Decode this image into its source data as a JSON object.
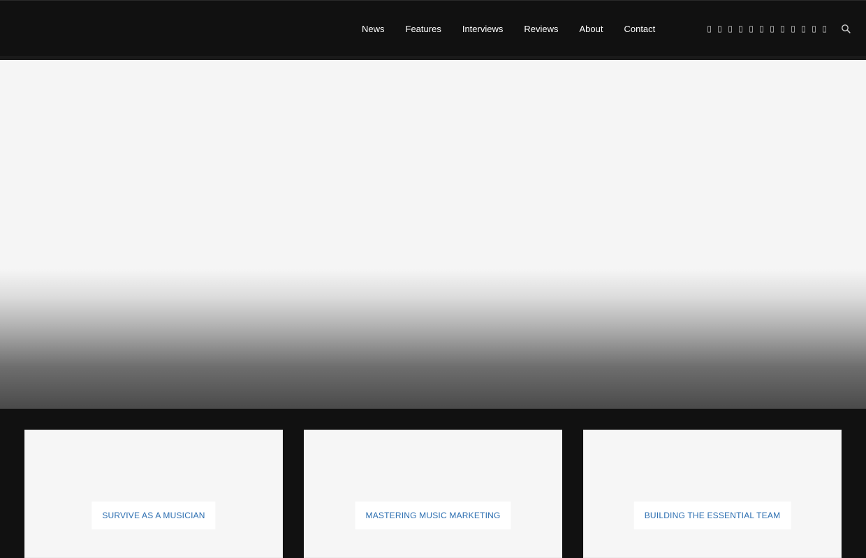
{
  "nav": {
    "items": [
      {
        "label": "News"
      },
      {
        "label": "Features"
      },
      {
        "label": "Interviews"
      },
      {
        "label": "Reviews"
      },
      {
        "label": "About"
      },
      {
        "label": "Contact"
      }
    ]
  },
  "social": {
    "icons": [
      "facebook-icon",
      "twitter-icon",
      "instagram-icon",
      "youtube-icon",
      "soundcloud-icon",
      "spotify-icon",
      "pinterest-icon",
      "tumblr-icon",
      "linkedin-icon",
      "vimeo-icon",
      "rss-icon",
      "email-icon"
    ]
  },
  "cards": [
    {
      "label": "SURVIVE AS A MUSICIAN"
    },
    {
      "label": "MASTERING MUSIC MARKETING"
    },
    {
      "label": "BUILDING THE ESSENTIAL TEAM"
    }
  ],
  "colors": {
    "header_bg": "#111111",
    "hero_light": "#f5f5f5",
    "card_bg": "#f6f6f6",
    "card_label_text": "#2a6db0"
  }
}
